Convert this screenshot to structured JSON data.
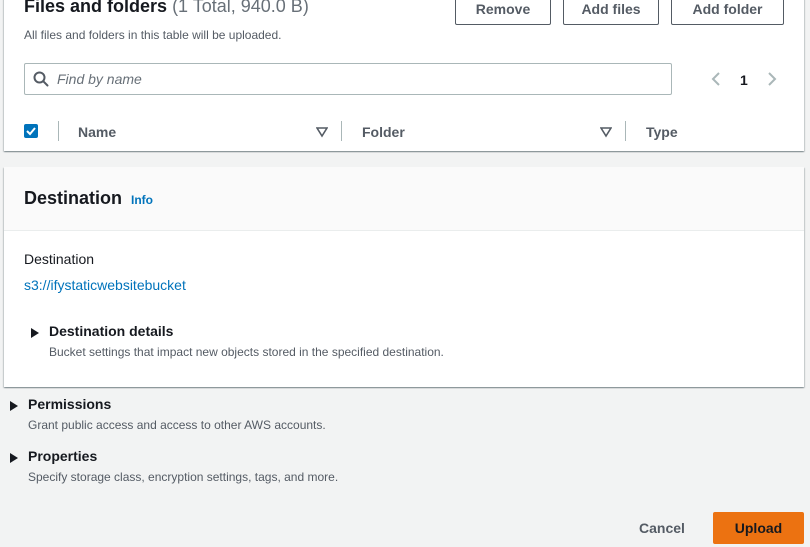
{
  "files_panel": {
    "title": "Files and folders",
    "count_text": "(1 Total, 940.0 B)",
    "description": "All files and folders in this table will be uploaded.",
    "remove_label": "Remove",
    "add_files_label": "Add files",
    "add_folder_label": "Add folder",
    "search_placeholder": "Find by name",
    "search_value": "",
    "page_number": "1",
    "columns": [
      "Name",
      "Folder",
      "Type"
    ]
  },
  "destination_panel": {
    "title": "Destination",
    "info_label": "Info",
    "destination_label": "Destination",
    "destination_value": "s3://ifystaticwebsitebucket",
    "details_title": "Destination details",
    "details_desc": "Bucket settings that impact new objects stored in the specified destination."
  },
  "permissions": {
    "title": "Permissions",
    "desc": "Grant public access and access to other AWS accounts."
  },
  "properties": {
    "title": "Properties",
    "desc": "Specify storage class, encryption settings, tags, and more."
  },
  "footer": {
    "cancel_label": "Cancel",
    "upload_label": "Upload"
  },
  "colors": {
    "accent": "#ec7211",
    "link": "#0073bb",
    "background": "#f2f3f3"
  }
}
